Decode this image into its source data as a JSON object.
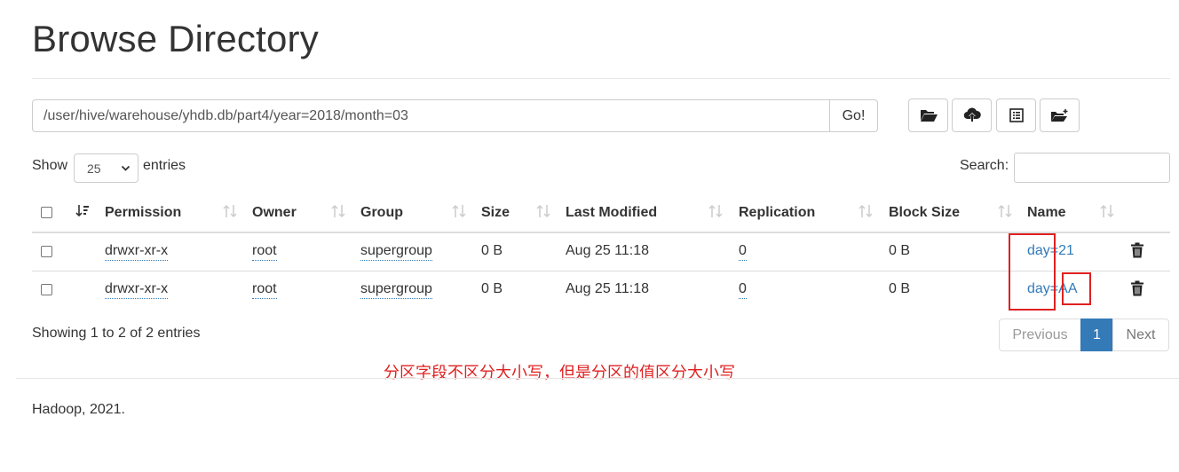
{
  "page_title": "Browse Directory",
  "path_bar": {
    "path": "/user/hive/warehouse/yhdb.db/part4/year=2018/month=03",
    "go_label": "Go!"
  },
  "toolbar": [
    "folder-open-icon",
    "cloud-upload-icon",
    "list-alt-icon",
    "new-folder-icon"
  ],
  "entries": {
    "show_label": "Show",
    "selected": "25",
    "entries_label": "entries"
  },
  "search": {
    "label": "Search:",
    "value": ""
  },
  "table": {
    "columns": [
      "Permission",
      "Owner",
      "Group",
      "Size",
      "Last Modified",
      "Replication",
      "Block Size",
      "Name"
    ],
    "rows": [
      {
        "permission": "drwxr-xr-x",
        "owner": "root",
        "group": "supergroup",
        "size": "0 B",
        "last_modified": "Aug 25 11:18",
        "replication": "0",
        "block_size": "0 B",
        "name_key": "day",
        "name_sep": "=",
        "name_value": "21"
      },
      {
        "permission": "drwxr-xr-x",
        "owner": "root",
        "group": "supergroup",
        "size": "0 B",
        "last_modified": "Aug 25 11:18",
        "replication": "0",
        "block_size": "0 B",
        "name_key": "day",
        "name_sep": "=",
        "name_value": "AA"
      }
    ]
  },
  "showing_text": "Showing 1 to 2 of 2 entries",
  "pagination": {
    "previous": "Previous",
    "current": "1",
    "next": "Next"
  },
  "annotation": "分区字段不区分大小写，但是分区的值区分大小写",
  "footer": "Hadoop, 2021.",
  "colors": {
    "link": "#337ab7",
    "annotation": "#e02020",
    "active_page": "#337ab7"
  }
}
